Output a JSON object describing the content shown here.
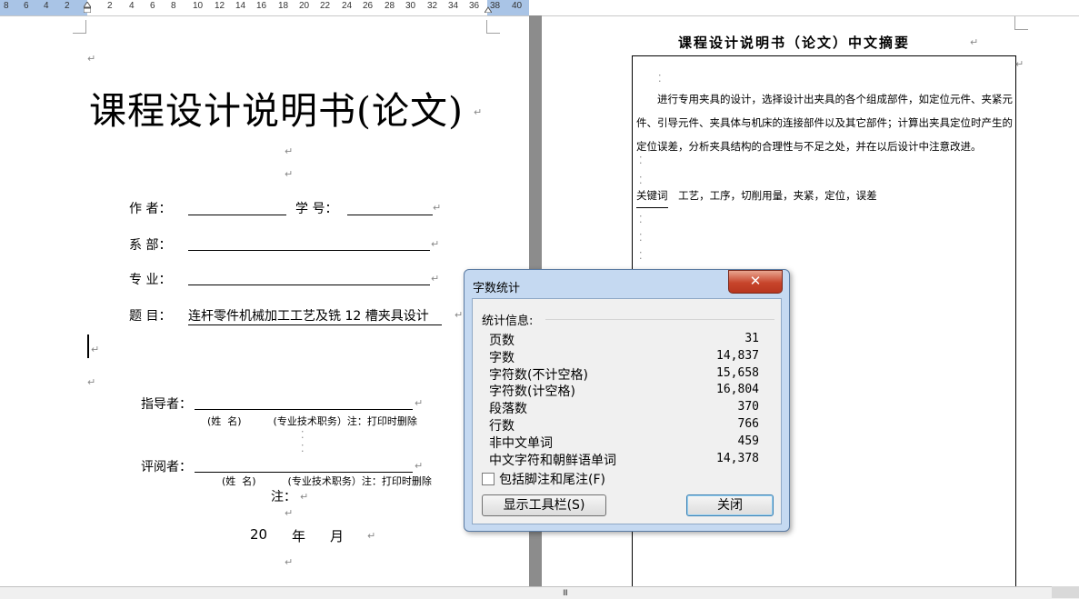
{
  "ruler": {
    "numbers": [
      "8",
      "6",
      "4",
      "2",
      "2",
      "4",
      "6",
      "8",
      "10",
      "12",
      "14",
      "16",
      "18",
      "20",
      "22",
      "24",
      "26",
      "28",
      "30",
      "32",
      "34",
      "36",
      "38",
      "40"
    ]
  },
  "page1": {
    "title": "课程设计说明书(论文)",
    "author_label": "作    者：",
    "student_id_label": "学  号：",
    "dept_label": "系    部：",
    "major_label": "专    业：",
    "topic_label": "题    目：",
    "topic_value": "连杆零件机械加工工艺及铣 12 槽夹具设计",
    "advisor_label": "指导者：",
    "advisor_note": "(姓  名)          (专业技术职务）注：打印时删除",
    "reviewer_label": "评阅者：",
    "reviewer_note": "(姓  名)          (专业技术职务）注：打印时删除",
    "note_label": "注：",
    "date_year": "20",
    "date_year_unit": "年",
    "date_month_unit": "月"
  },
  "page2": {
    "title": "课程设计说明书（论文）中文摘要",
    "abstract": "进行专用夹具的设计，选择设计出夹具的各个组成部件，如定位元件、夹紧元件、引导元件、夹具体与机床的连接部件以及其它部件；计算出夹具定位时产生的定位误差，分析夹具结构的合理性与不足之处，并在以后设计中注意改进。",
    "keywords_label": "关键词",
    "keywords": "工艺，工序，切削用量，夹紧，定位，误差"
  },
  "dialog": {
    "title": "字数统计",
    "close_glyph": "✕",
    "group_label": "统计信息:",
    "stats": [
      {
        "label": "页数",
        "value": "31"
      },
      {
        "label": "字数",
        "value": "14,837"
      },
      {
        "label": "字符数(不计空格)",
        "value": "15,658"
      },
      {
        "label": "字符数(计空格)",
        "value": "16,804"
      },
      {
        "label": "段落数",
        "value": "370"
      },
      {
        "label": "行数",
        "value": "766"
      },
      {
        "label": "非中文单词",
        "value": "459"
      },
      {
        "label": "中文字符和朝鲜语单词",
        "value": "14,378"
      }
    ],
    "checkbox_label": "包括脚注和尾注(F)",
    "show_toolbar_button": "显示工具栏(S)",
    "close_button": "关闭"
  },
  "scrollbar": {
    "grip": "III"
  },
  "colors": {
    "ruler_margin": "#a9c4e6",
    "dialog_frame": "#c5d9f1",
    "close_red": "#c7442b"
  }
}
